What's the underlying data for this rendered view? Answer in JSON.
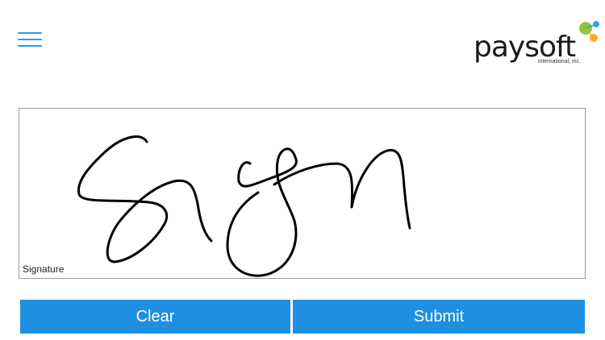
{
  "header": {
    "menu_icon": "hamburger-menu-icon",
    "logo": {
      "brand": "paysoft",
      "tagline": "international, inc."
    }
  },
  "signature_pad": {
    "label": "Signature"
  },
  "actions": {
    "clear_label": "Clear",
    "submit_label": "Submit"
  },
  "colors": {
    "accent": "#1f8fe0",
    "menu_icon": "#2a9ae0",
    "logo_green": "#8cc63f",
    "logo_blue": "#29abe2",
    "logo_orange": "#f7a823"
  }
}
